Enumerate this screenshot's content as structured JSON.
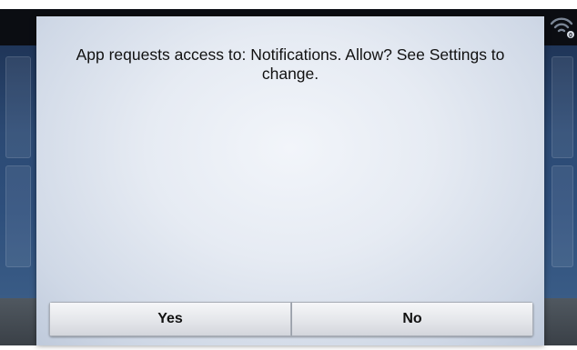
{
  "dialog": {
    "message": "App requests access to: Notifications. Allow? See Settings to change.",
    "yes_label": "Yes",
    "no_label": "No"
  },
  "status_bar": {
    "wifi_icon": "wifi-icon"
  },
  "colors": {
    "status_bar": "#0b0d12",
    "background_blue": "#2c4a74",
    "dialog_background": "#e6ebf3",
    "button_background": "#e4e6ea",
    "text": "#111111"
  }
}
